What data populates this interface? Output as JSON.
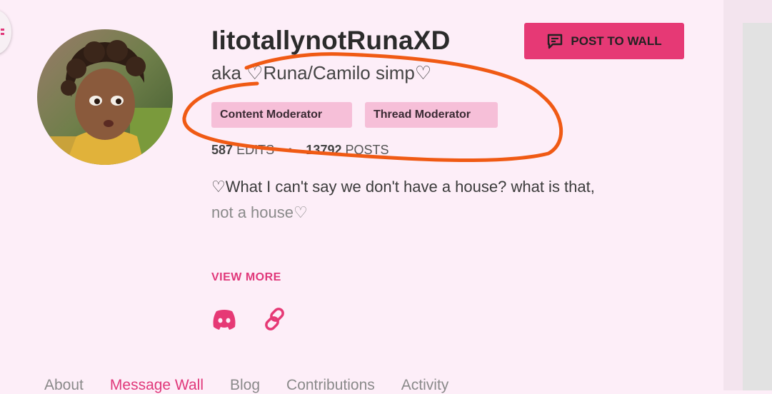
{
  "profile": {
    "username": "IitotallynotRunaXD",
    "alias": "aka ♡Runa/Camilo simp♡",
    "post_button_label": "POST TO WALL",
    "tags": [
      "Content Moderator",
      "Thread Moderator"
    ],
    "stats": {
      "edits_count": "587",
      "edits_label": "EDITS",
      "separator": "•",
      "posts_count": "13792",
      "posts_label": "POSTS"
    },
    "bio_line1": "♡What I can't say we don't have a house? what is that,",
    "bio_line2": "not a house♡",
    "view_more_label": "VIEW MORE"
  },
  "tabs": [
    {
      "label": "About",
      "active": false
    },
    {
      "label": "Message Wall",
      "active": true
    },
    {
      "label": "Blog",
      "active": false
    },
    {
      "label": "Contributions",
      "active": false
    },
    {
      "label": "Activity",
      "active": false
    }
  ],
  "colors": {
    "accent": "#e63975",
    "tag_bg": "#f6bfd8",
    "page_bg": "#fdeef8",
    "annotation": "#f05a14"
  },
  "icons": [
    "discord-icon",
    "link-icon",
    "message-icon"
  ]
}
